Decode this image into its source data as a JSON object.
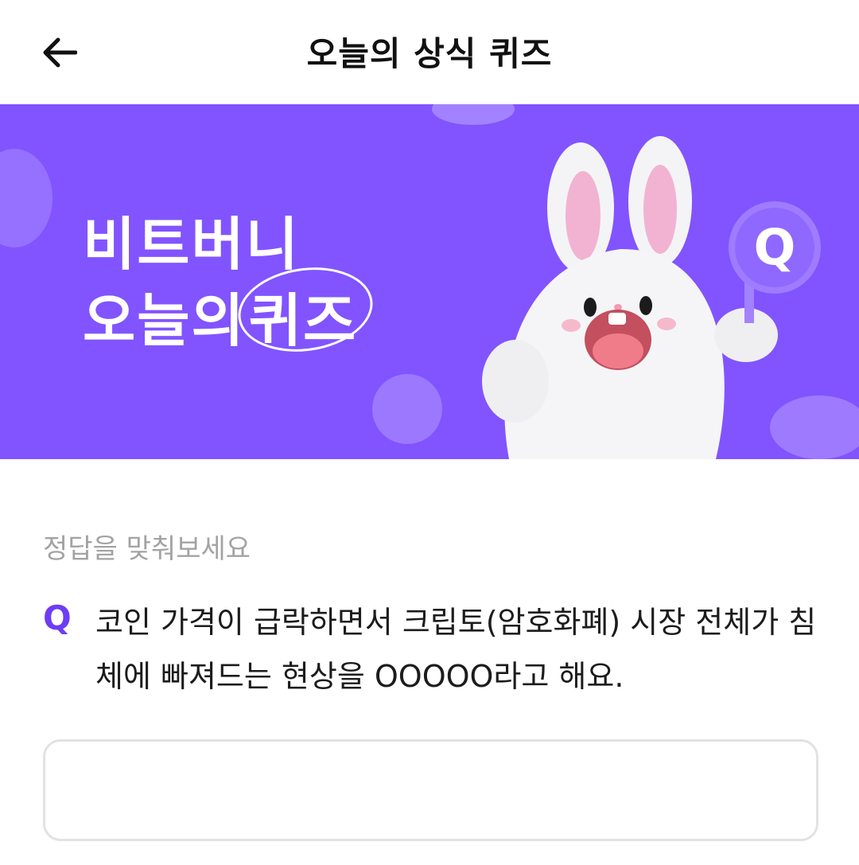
{
  "header": {
    "back_icon": "arrow-left-icon",
    "title": "오늘의 상식 퀴즈"
  },
  "banner": {
    "line1": "비트버니",
    "line2_prefix": "오늘의",
    "line2_highlight": "퀴즈",
    "badge_letter": "Q",
    "background_color": "#8154ff"
  },
  "quiz": {
    "prompt": "정답을 맞춰보세요",
    "q_label": "Q",
    "question": "코인 가격이 급락하면서 크립토(암호화폐) 시장 전체가 침체에 빠져드는 현상을 OOOOO라고 해요.",
    "answer_value": "",
    "accent_color": "#6d3df5"
  }
}
